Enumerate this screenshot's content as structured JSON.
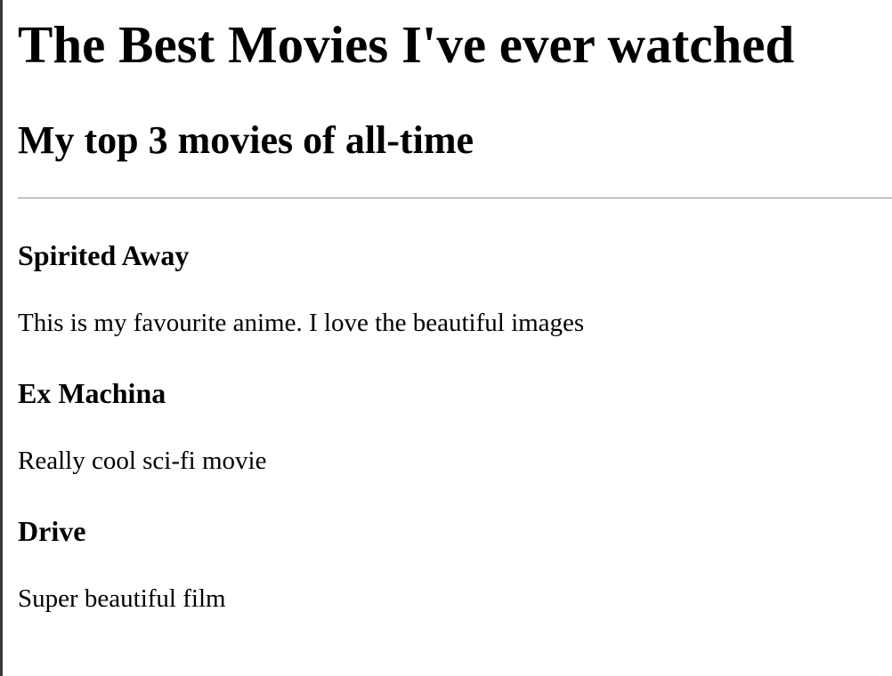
{
  "page": {
    "title": "The Best Movies I've ever watched",
    "subtitle": "My top 3 movies of all-time"
  },
  "movies": [
    {
      "title": "Spirited Away",
      "description": "This is my favourite anime. I love the beautiful images"
    },
    {
      "title": "Ex Machina",
      "description": "Really cool sci-fi movie"
    },
    {
      "title": "Drive",
      "description": "Super beautiful film"
    }
  ]
}
